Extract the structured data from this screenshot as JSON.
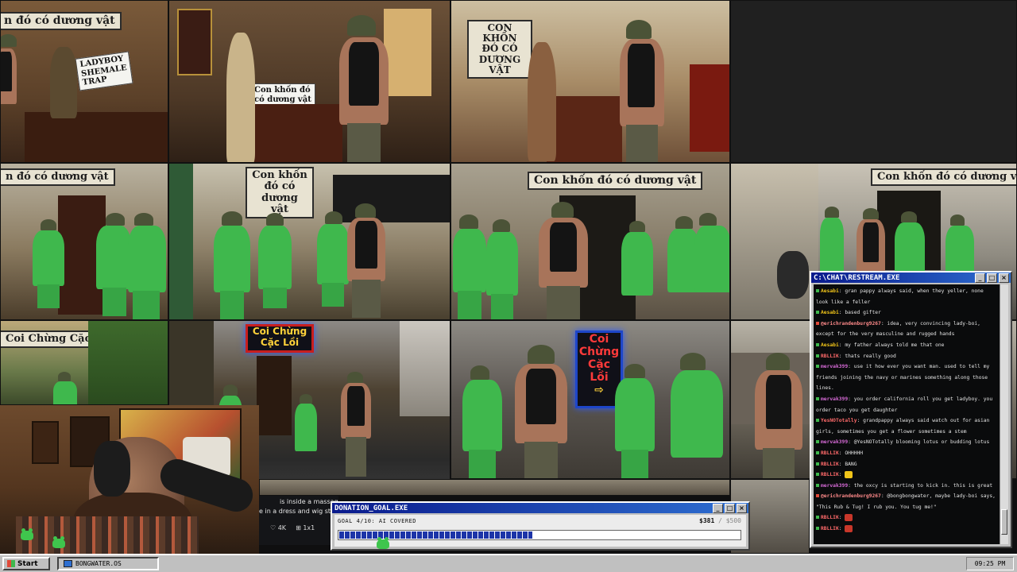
{
  "grid": {
    "signs": {
      "t1": "n đó có dương vật",
      "t2_board_lines": [
        "LADYBOY",
        "SHEMALE",
        "TRAP"
      ],
      "t3_card_lines": [
        "Con khốn đó",
        "có dương vật"
      ],
      "t4": "CON KHỐN ĐÓ CÓ DƯƠNG VẬT",
      "t5": "n đó có dương vật",
      "t6": "Con khốn đó có dương vật",
      "t7": "Con khốn đó có dương vật",
      "t8": "Con khốn đó có dương vật",
      "t9": "Coi Chừng Cặc Lồi",
      "t10_neon": "Coi Chừng Cặc Lồi",
      "t11_neon_lines": [
        "Coi",
        "Chừng",
        "Cặc Lồi"
      ],
      "t11_arrow": "⇨"
    }
  },
  "post": {
    "line1": "is inside a massag",
    "line2": "e in a dress and wig stanc",
    "likes": "4K",
    "reposts": "1x1"
  },
  "chat": {
    "title": "C:\\CHAT\\RESTREAM.EXE",
    "messages": [
      {
        "user": "",
        "text": "gran pappy always said, when they yeller, none look like a feller",
        "prefix": "Aesabi",
        "color": "#f0c419",
        "bullet": "green"
      },
      {
        "user": "Aesabi",
        "text": "based gifter",
        "color": "#f0c419",
        "bullet": "green"
      },
      {
        "user": "@erichrandenburg9267",
        "text": "idea, very convincing lady-boi, except for the very masculine and rugged hands",
        "color": "#ff8a8a",
        "bullet": "red"
      },
      {
        "user": "Aesabi",
        "text": "my father always told me that one",
        "color": "#f0c419",
        "bullet": "green"
      },
      {
        "user": "RBLLIK",
        "text": "thats really good",
        "color": "#ff6a6a",
        "bullet": "green"
      },
      {
        "user": "mervak399",
        "text": "use it how ever you want man. used to tell my friends joining the navy or marines something along those lines.",
        "color": "#d56ad5",
        "bullet": "green"
      },
      {
        "user": "mervak399",
        "text": "you order california roll you get ladyboy. you order taco you get daughter",
        "color": "#d56ad5",
        "bullet": "green"
      },
      {
        "user": "YesNOTotally",
        "text": "grandpappy always said watch out for asian girls, sometimes you get a flower sometimes a stem",
        "color": "#ff6a6a",
        "bullet": "green"
      },
      {
        "user": "mervak399",
        "text": "@YesNOTotally blooming lotus or budding lotus",
        "color": "#d56ad5",
        "bullet": "green"
      },
      {
        "user": "RBLLIK",
        "text": "OHHHHH",
        "color": "#ff6a6a",
        "bullet": "green"
      },
      {
        "user": "RBLLIK",
        "text": "BANG",
        "color": "#ff6a6a",
        "bullet": "green"
      },
      {
        "user": "RBLLIK",
        "text": "",
        "color": "#ff6a6a",
        "bullet": "green",
        "emote": "yellow"
      },
      {
        "user": "mervak399",
        "text": "the oxcy is starting to kick in. this is great",
        "color": "#d56ad5",
        "bullet": "green"
      },
      {
        "user": "@erichrandenburg9267",
        "text": "@bongbongwater, maybe lady-boi says, \"This Rub & Tug! I rub you. You tug me!\"",
        "color": "#ff8a8a",
        "bullet": "red"
      },
      {
        "user": "RBLLIK",
        "text": "",
        "color": "#ff6a6a",
        "bullet": "green",
        "emote": "red"
      },
      {
        "user": "RBLLIK",
        "text": "",
        "color": "#ff6a6a",
        "bullet": "green",
        "emote": "red"
      }
    ]
  },
  "donation": {
    "title": "DONATION_GOAL.EXE",
    "label": "GOAL 4/10: AI COVERED",
    "amount": "$381",
    "max": "/ $500",
    "progress": 0.48
  },
  "taskbar": {
    "start_label": "Start",
    "task_label": "BONGWATER.OS",
    "clock": "09:25 PM"
  },
  "colors": {
    "titlebar": "#0a1a8c",
    "accent_green": "#3fb84d",
    "window_gray": "#c0c0c0"
  }
}
